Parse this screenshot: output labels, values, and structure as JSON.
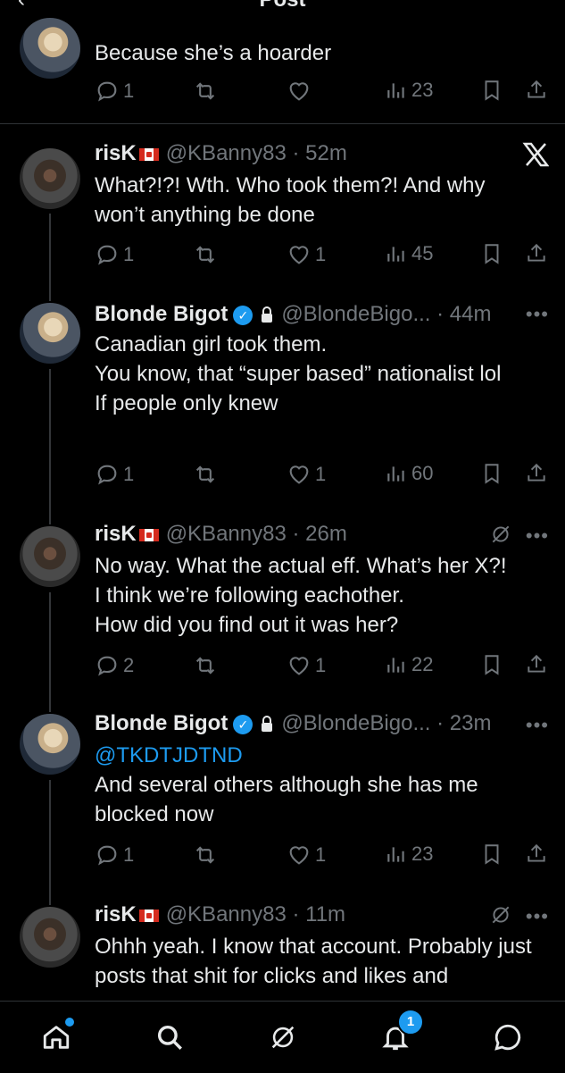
{
  "screen": {
    "title": "Post"
  },
  "posts": [
    {
      "id": "p0",
      "text": [
        "Because she’s a hoarder"
      ],
      "replies": "1",
      "likes": "",
      "views": "23"
    },
    {
      "id": "p1",
      "name": "risK",
      "handle": "@KBanny83",
      "time": "52m",
      "text": [
        "What?!?! Wth. Who took them?! And why won’t anything be done"
      ],
      "replies": "1",
      "likes": "1",
      "views": "45"
    },
    {
      "id": "p2",
      "name": "Blonde Bigot",
      "handle": "@BlondeBigo...",
      "time": "44m",
      "text": [
        "Canadian girl took them.",
        "You know, that “super based” nationalist lol",
        "If people only knew"
      ],
      "replies": "1",
      "likes": "1",
      "views": "60"
    },
    {
      "id": "p3",
      "name": "risK",
      "handle": "@KBanny83",
      "time": "26m",
      "text": [
        "No way. What the actual eff. What’s her X?!",
        "I think we’re following eachother.",
        "How did you find out it was her?"
      ],
      "replies": "2",
      "likes": "1",
      "views": "22"
    },
    {
      "id": "p4",
      "name": "Blonde Bigot",
      "handle": "@BlondeBigo...",
      "time": "23m",
      "mention": "@TKDTJDTND",
      "text": [
        "And several others although she has me blocked now"
      ],
      "replies": "1",
      "likes": "1",
      "views": "23"
    },
    {
      "id": "p5",
      "name": "risK",
      "handle": "@KBanny83",
      "time": "11m",
      "text": [
        "Ohhh yeah. I know that account. Probably just posts that shit for clicks and likes and"
      ]
    }
  ],
  "tabbar": {
    "notifications_badge": "1"
  },
  "colors": {
    "accent": "#1d9bf0",
    "muted": "#71767b",
    "text": "#e7e9ea",
    "background": "#000000"
  },
  "icons": [
    "reply-icon",
    "repost-icon",
    "like-icon",
    "views-icon",
    "bookmark-icon",
    "share-icon",
    "more-icon",
    "grok-icon",
    "x-logo-icon",
    "verified-icon",
    "lock-icon",
    "canada-flag-icon",
    "home-icon",
    "search-icon",
    "grok-tab-icon",
    "notifications-icon",
    "messages-icon"
  ]
}
